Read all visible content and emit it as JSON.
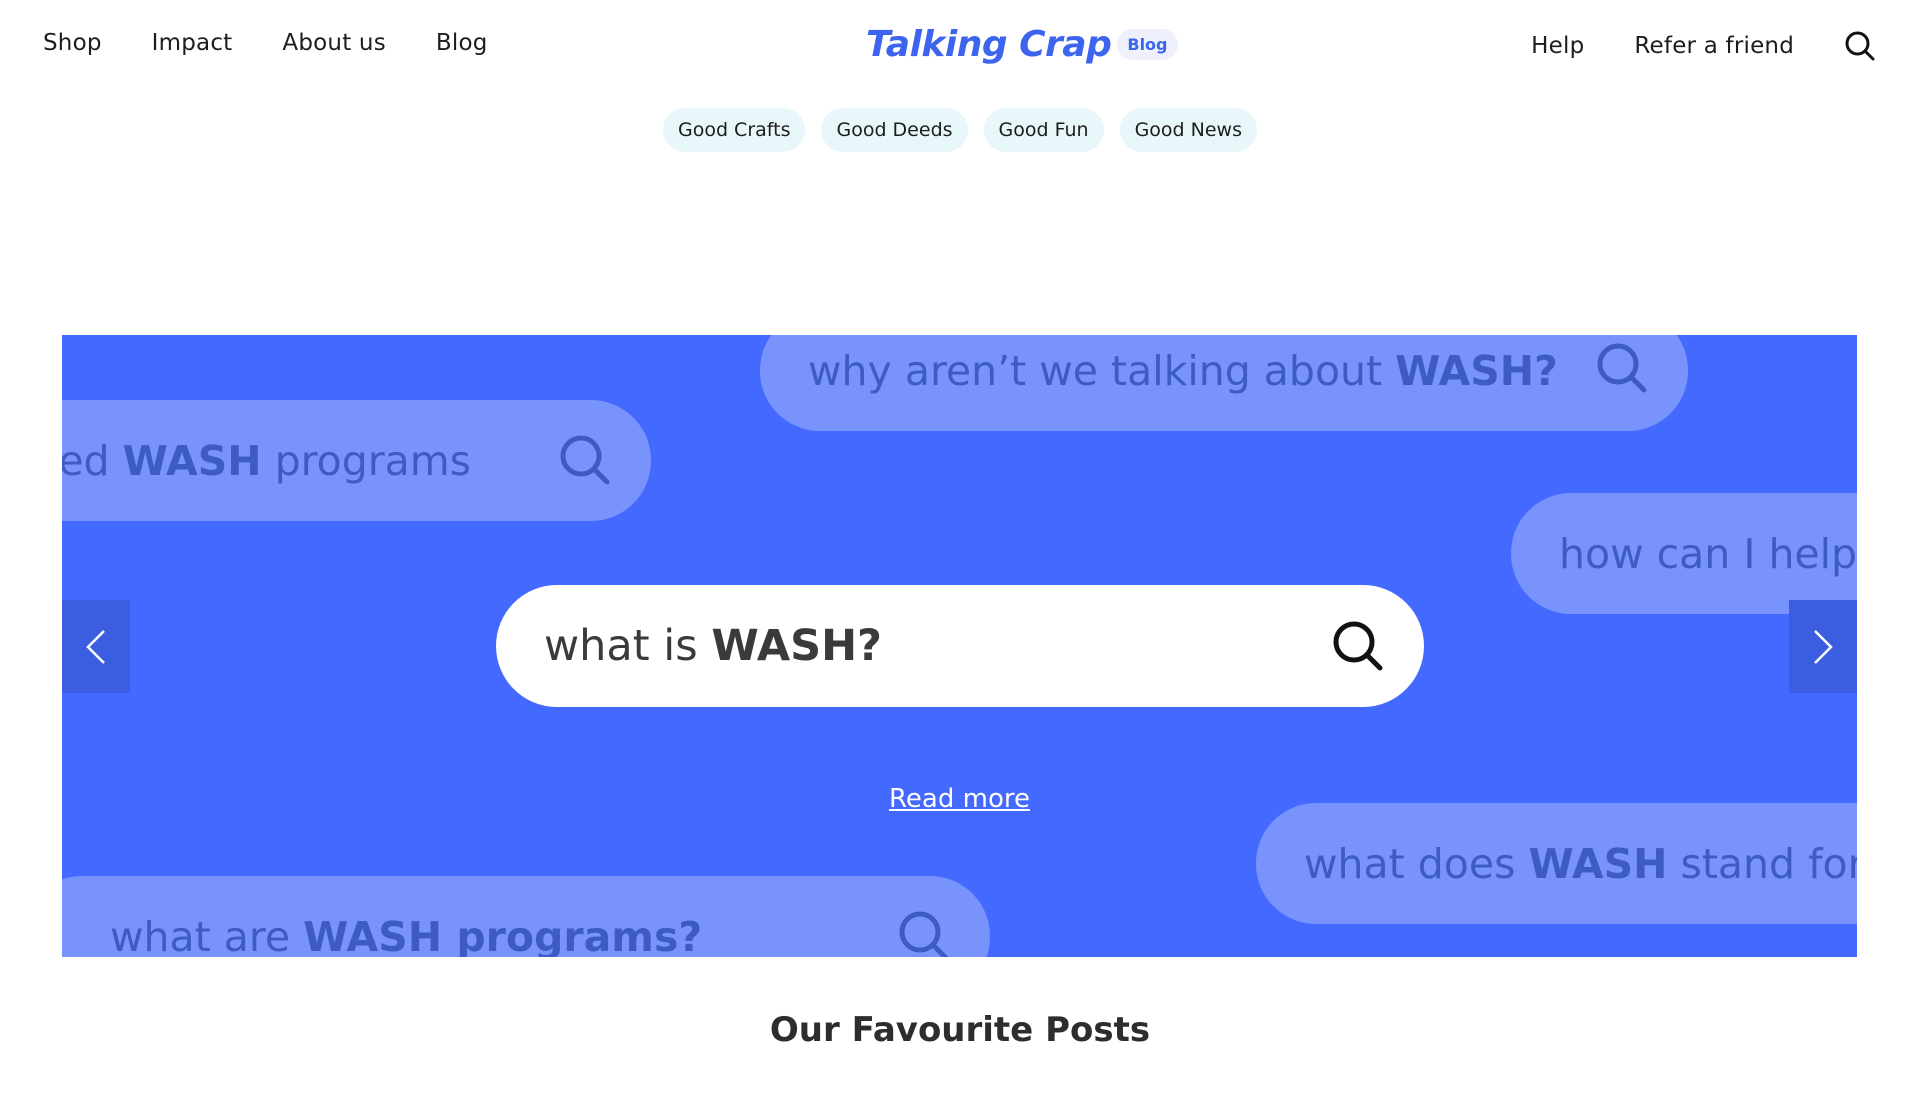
{
  "header": {
    "nav_left": [
      "Shop",
      "Impact",
      "About us",
      "Blog"
    ],
    "logo": {
      "text": "Talking Crap",
      "badge": "Blog"
    },
    "nav_right": [
      "Help",
      "Refer a friend"
    ],
    "search_icon": "search-icon"
  },
  "categories": [
    "Good Crafts",
    "Good Deeds",
    "Good Fun",
    "Good News"
  ],
  "banner": {
    "background_color": "#4369ff",
    "bubbles": [
      {
        "pre": "why aren’t we talking about ",
        "bold": "WASH?",
        "post": "",
        "icon": "search-icon"
      },
      {
        "pre": "eed ",
        "bold": "WASH",
        "post": " programs",
        "icon": "search-icon"
      },
      {
        "pre": "how can I help?",
        "bold": "",
        "post": "",
        "icon": ""
      },
      {
        "pre": "what does ",
        "bold": "WASH",
        "post": " stand for",
        "icon": ""
      },
      {
        "pre": "what are ",
        "bold": "WASH programs?",
        "post": "",
        "icon": "search-icon"
      }
    ],
    "main_search": {
      "pre": "what is ",
      "bold": "WASH?",
      "icon": "search-icon"
    },
    "read_more": "Read more",
    "prev_icon": "chevron-left-icon",
    "next_icon": "chevron-right-icon"
  },
  "section": {
    "title": "Our Favourite Posts"
  }
}
